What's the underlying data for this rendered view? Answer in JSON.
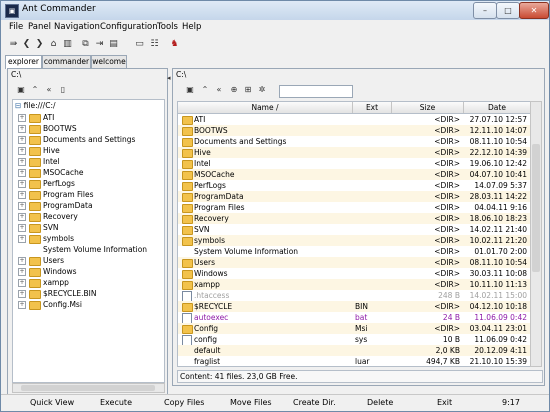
{
  "window": {
    "title": "Ant Commander",
    "minimize": "–",
    "maximize": "□",
    "close": "✕"
  },
  "menu": [
    "File",
    "Panel",
    "Navigation",
    "Configuration",
    "Tools",
    "Help"
  ],
  "toolbar_icons": [
    "go-icon",
    "back-icon",
    "forward-icon",
    "home-icon",
    "copy-file-icon",
    "move-file-icon",
    "new-file-icon",
    "rename-icon",
    "properties-icon",
    "ant-icon"
  ],
  "tabs": [
    "explorer",
    "commander",
    "welcome"
  ],
  "left_panel": {
    "path": "C:\\",
    "root_label": "file:///C:/",
    "tree": [
      {
        "label": "ATI",
        "expandable": true,
        "folder": true
      },
      {
        "label": "BOOTWS",
        "expandable": true,
        "folder": true
      },
      {
        "label": "Documents and Settings",
        "expandable": true,
        "folder": true
      },
      {
        "label": "Hive",
        "expandable": true,
        "folder": true
      },
      {
        "label": "Intel",
        "expandable": true,
        "folder": true
      },
      {
        "label": "MSOCache",
        "expandable": true,
        "folder": true
      },
      {
        "label": "PerfLogs",
        "expandable": true,
        "folder": true
      },
      {
        "label": "Program Files",
        "expandable": true,
        "folder": true
      },
      {
        "label": "ProgramData",
        "expandable": true,
        "folder": true
      },
      {
        "label": "Recovery",
        "expandable": true,
        "folder": true
      },
      {
        "label": "SVN",
        "expandable": true,
        "folder": true
      },
      {
        "label": "symbols",
        "expandable": true,
        "folder": true
      },
      {
        "label": "System Volume Information",
        "expandable": false,
        "folder": false
      },
      {
        "label": "Users",
        "expandable": true,
        "folder": true
      },
      {
        "label": "Windows",
        "expandable": true,
        "folder": true
      },
      {
        "label": "xampp",
        "expandable": true,
        "folder": true
      },
      {
        "label": "$RECYCLE.BIN",
        "expandable": true,
        "folder": true
      },
      {
        "label": "Config.Msi",
        "expandable": true,
        "folder": true
      }
    ]
  },
  "right_panel": {
    "path": "C:\\",
    "columns": {
      "name": "Name /",
      "ext": "Ext",
      "size": "Size",
      "date": "Date"
    },
    "rows": [
      {
        "name": "ATI",
        "ext": "",
        "size": "<DIR>",
        "date": "27.07.10 12:57",
        "type": "folder",
        "dim": false,
        "color": ""
      },
      {
        "name": "BOOTWS",
        "ext": "",
        "size": "<DIR>",
        "date": "12.11.10 14:07",
        "type": "folder",
        "dim": false,
        "color": ""
      },
      {
        "name": "Documents and Settings",
        "ext": "",
        "size": "<DIR>",
        "date": "08.11.10 10:54",
        "type": "folder",
        "dim": false,
        "color": ""
      },
      {
        "name": "Hive",
        "ext": "",
        "size": "<DIR>",
        "date": "22.12.10 14:39",
        "type": "folder",
        "dim": false,
        "color": ""
      },
      {
        "name": "Intel",
        "ext": "",
        "size": "<DIR>",
        "date": "19.06.10 12:42",
        "type": "folder",
        "dim": false,
        "color": ""
      },
      {
        "name": "MSOCache",
        "ext": "",
        "size": "<DIR>",
        "date": "04.07.10 10:41",
        "type": "folder",
        "dim": false,
        "color": ""
      },
      {
        "name": "PerfLogs",
        "ext": "",
        "size": "<DIR>",
        "date": "14.07.09 5:37",
        "type": "folder",
        "dim": false,
        "color": ""
      },
      {
        "name": "ProgramData",
        "ext": "",
        "size": "<DIR>",
        "date": "28.03.11 14:22",
        "type": "folder",
        "dim": false,
        "color": ""
      },
      {
        "name": "Program Files",
        "ext": "",
        "size": "<DIR>",
        "date": "04.04.11 9:16",
        "type": "folder",
        "dim": false,
        "color": ""
      },
      {
        "name": "Recovery",
        "ext": "",
        "size": "<DIR>",
        "date": "18.06.10 18:23",
        "type": "folder",
        "dim": false,
        "color": ""
      },
      {
        "name": "SVN",
        "ext": "",
        "size": "<DIR>",
        "date": "14.02.11 21:40",
        "type": "folder",
        "dim": false,
        "color": ""
      },
      {
        "name": "symbols",
        "ext": "",
        "size": "<DIR>",
        "date": "10.02.11 21:20",
        "type": "folder",
        "dim": false,
        "color": ""
      },
      {
        "name": "System Volume Information",
        "ext": "",
        "size": "<DIR>",
        "date": "01.01.70 2:00",
        "type": "none",
        "dim": false,
        "color": ""
      },
      {
        "name": "Users",
        "ext": "",
        "size": "<DIR>",
        "date": "08.11.10 10:54",
        "type": "folder",
        "dim": false,
        "color": ""
      },
      {
        "name": "Windows",
        "ext": "",
        "size": "<DIR>",
        "date": "30.03.11 10:08",
        "type": "folder",
        "dim": false,
        "color": ""
      },
      {
        "name": "xampp",
        "ext": "",
        "size": "<DIR>",
        "date": "10.11.10 11:13",
        "type": "folder",
        "dim": false,
        "color": ""
      },
      {
        "name": ".htaccess",
        "ext": "",
        "size": "248 B",
        "date": "14.02.11 15:00",
        "type": "file",
        "dim": true,
        "color": ""
      },
      {
        "name": "$RECYCLE",
        "ext": "BIN",
        "size": "<DIR>",
        "date": "04.12.10 10:18",
        "type": "folder",
        "dim": false,
        "color": ""
      },
      {
        "name": "autoexec",
        "ext": "bat",
        "size": "24 B",
        "date": "11.06.09 0:42",
        "type": "file",
        "dim": false,
        "color": "#8e1aa8"
      },
      {
        "name": "Config",
        "ext": "Msi",
        "size": "<DIR>",
        "date": "03.04.11 23:01",
        "type": "folder",
        "dim": false,
        "color": ""
      },
      {
        "name": "config",
        "ext": "sys",
        "size": "10 B",
        "date": "11.06.09 0:42",
        "type": "file",
        "dim": false,
        "color": ""
      },
      {
        "name": "default",
        "ext": "",
        "size": "2,0 KB",
        "date": "20.12.09 4:11",
        "type": "none",
        "dim": false,
        "color": ""
      },
      {
        "name": "fraglist",
        "ext": "luar",
        "size": "494,7 KB",
        "date": "21.10.10 15:39",
        "type": "none",
        "dim": false,
        "color": ""
      }
    ],
    "status": "Content: 41 files.   23,0 GB Free."
  },
  "function_bar": [
    "Quick View",
    "Execute",
    "Copy Files",
    "Move Files",
    "Create Dir.",
    "Delete",
    "Exit"
  ],
  "clock": "9:17",
  "colors": {
    "folder": "#f2c24b",
    "alt_row": "#fdf6e3",
    "dim_text": "#a0a0a0",
    "script_file": "#8e1aa8"
  }
}
